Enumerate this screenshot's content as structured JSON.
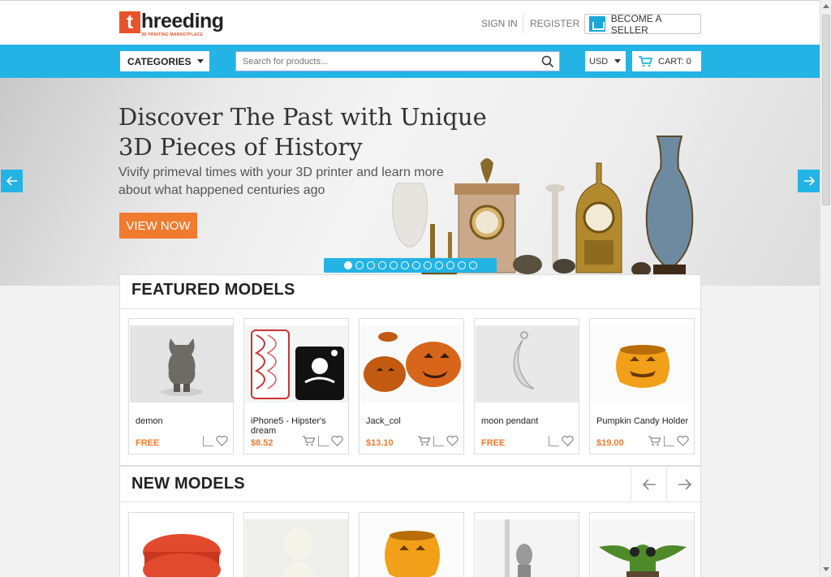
{
  "header": {
    "logo_letter": "t",
    "logo_name": "hreeding",
    "logo_tagline": "3D PRINTING MARKETPLACE",
    "sign_in": "SIGN IN",
    "register": "REGISTER",
    "become_seller": "BECOME A SELLER"
  },
  "nav": {
    "categories": "CATEGORIES",
    "search_placeholder": "Search for products...",
    "currency": "USD",
    "cart": "CART: 0"
  },
  "hero": {
    "title": "Discover The Past with Unique 3D Pieces of History",
    "subtitle": "Vivify primeval times with your 3D printer and learn more about what happened centuries ago",
    "cta": "VIEW NOW",
    "slide_count": 12,
    "active_slide": 1
  },
  "featured": {
    "title": "FEATURED MODELS",
    "items": [
      {
        "name": "demon",
        "price": "FREE",
        "cart": false
      },
      {
        "name": "iPhone5 - Hipster's dream",
        "price": "$8.52",
        "cart": true
      },
      {
        "name": "Jack_col",
        "price": "$13.10",
        "cart": true
      },
      {
        "name": "moon pendant",
        "price": "FREE",
        "cart": false
      },
      {
        "name": "Pumpkin Candy Holder",
        "price": "$19.00",
        "cart": true
      }
    ]
  },
  "new_models": {
    "title": "NEW MODELS"
  },
  "colors": {
    "accent_blue": "#23b4e5",
    "accent_orange": "#f07b2f"
  }
}
